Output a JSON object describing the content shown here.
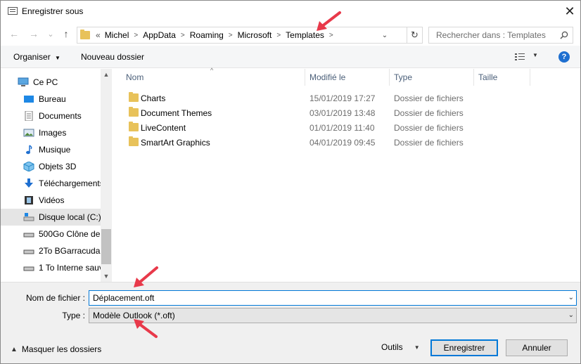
{
  "window": {
    "title": "Enregistrer sous",
    "close_glyph": "✕"
  },
  "nav": {
    "back_glyph": "←",
    "forward_glyph": "→",
    "recent_glyph": "⌄",
    "up_glyph": "↑",
    "overflow": "«",
    "breadcrumbs": [
      "Michel",
      "AppData",
      "Roaming",
      "Microsoft",
      "Templates"
    ],
    "refresh_glyph": "↻",
    "search_placeholder": "Rechercher dans : Templates"
  },
  "toolbar": {
    "organize_label": "Organiser",
    "new_folder_label": "Nouveau dossier",
    "help_glyph": "?"
  },
  "sidebar": {
    "items": [
      {
        "label": "Ce PC",
        "icon": "computer-icon"
      },
      {
        "label": "Bureau",
        "icon": "desktop-icon"
      },
      {
        "label": "Documents",
        "icon": "documents-icon"
      },
      {
        "label": "Images",
        "icon": "images-icon"
      },
      {
        "label": "Musique",
        "icon": "music-icon"
      },
      {
        "label": "Objets 3D",
        "icon": "cube-icon"
      },
      {
        "label": "Téléchargements",
        "icon": "download-icon"
      },
      {
        "label": "Vidéos",
        "icon": "video-icon"
      },
      {
        "label": "Disque local (C:)",
        "icon": "drive-icon"
      },
      {
        "label": "500Go Clône de",
        "icon": "drive-icon"
      },
      {
        "label": "2To BGarracuda",
        "icon": "drive-icon"
      },
      {
        "label": "1 To Interne sauv",
        "icon": "drive-icon"
      }
    ]
  },
  "files": {
    "columns": [
      "Nom",
      "Modifié le",
      "Type",
      "Taille"
    ],
    "rows": [
      {
        "name": "Charts",
        "date": "15/01/2019 17:27",
        "type": "Dossier de fichiers"
      },
      {
        "name": "Document Themes",
        "date": "03/01/2019 13:48",
        "type": "Dossier de fichiers"
      },
      {
        "name": "LiveContent",
        "date": "01/01/2019 11:40",
        "type": "Dossier de fichiers"
      },
      {
        "name": "SmartArt Graphics",
        "date": "04/01/2019 09:45",
        "type": "Dossier de fichiers"
      }
    ]
  },
  "form": {
    "filename_label": "Nom de fichier :",
    "filename_value": "Déplacement.oft",
    "type_label": "Type :",
    "type_value": "Modèle Outlook (*.oft)",
    "hide_folders_label": "Masquer les dossiers",
    "tools_label": "Outils",
    "save_label": "Enregistrer",
    "cancel_label": "Annuler"
  },
  "colors": {
    "accent": "#0078d7",
    "selected": "#cce8ff",
    "annotation": "#e8394a",
    "folder": "#e8c25a"
  }
}
